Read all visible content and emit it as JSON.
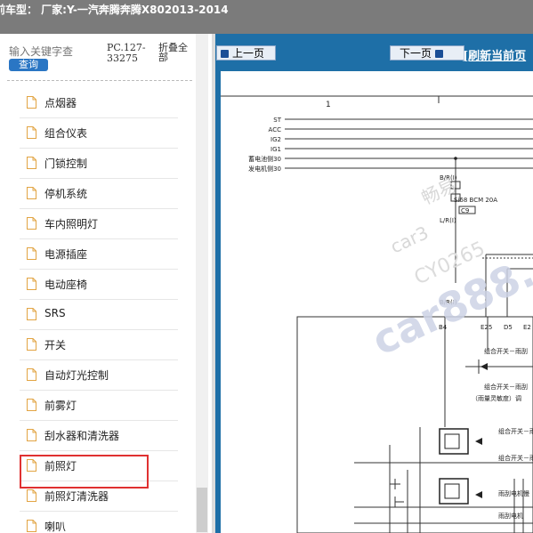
{
  "header": {
    "title": "前车型：  厂家:Y-一汽奔腾奔腾X802013-2014"
  },
  "sidebar": {
    "search": {
      "placeholder": "输入关键字查",
      "button_label": "查询"
    },
    "pc_code": "PC.127-33275",
    "collapse_label": "折叠全部",
    "items": [
      {
        "label": "点烟器"
      },
      {
        "label": "组合仪表"
      },
      {
        "label": "门锁控制"
      },
      {
        "label": "停机系统"
      },
      {
        "label": "车内照明灯"
      },
      {
        "label": "电源插座"
      },
      {
        "label": "电动座椅"
      },
      {
        "label": "SRS"
      },
      {
        "label": "开关"
      },
      {
        "label": "自动灯光控制"
      },
      {
        "label": "前雾灯"
      },
      {
        "label": "刮水器和清洗器"
      },
      {
        "label": "前照灯"
      },
      {
        "label": "前照灯清洗器"
      },
      {
        "label": "喇叭"
      }
    ],
    "selected_index": 11
  },
  "viewer": {
    "prev_label": "上一页",
    "next_label": "下一页",
    "refresh_label": "[刷新当前页",
    "diagram": {
      "column_number": "1",
      "power_lines": [
        "ST",
        "ACC",
        "IG2",
        "IG1",
        "蓄电池侧30",
        "发电机侧30"
      ],
      "wire_color_1": "B/R(I)",
      "fuse_label": "Si68 BCM 20A",
      "connector_c9": "C9",
      "wire_color_2": "L/R(I)",
      "wire_color_3": "B/R(I)",
      "pin_labels": [
        "B4",
        "E25",
        "D5",
        "E2"
      ],
      "switch_texts": [
        "组合开关－雨刮",
        "组合开关－雨刮",
        "（雨量灵敏度）调",
        "组合开关－雨",
        "组合开关－雨",
        "雨刮电机慢",
        "雨刮电机"
      ],
      "watermarks": [
        "畅易",
        "car3",
        "CY0265",
        "car888.c"
      ]
    }
  },
  "colors": {
    "topbar": "#7b7b7b",
    "viewer_bg": "#1e6fa7",
    "search_button": "#2a76c4",
    "highlight": "#e03131"
  }
}
